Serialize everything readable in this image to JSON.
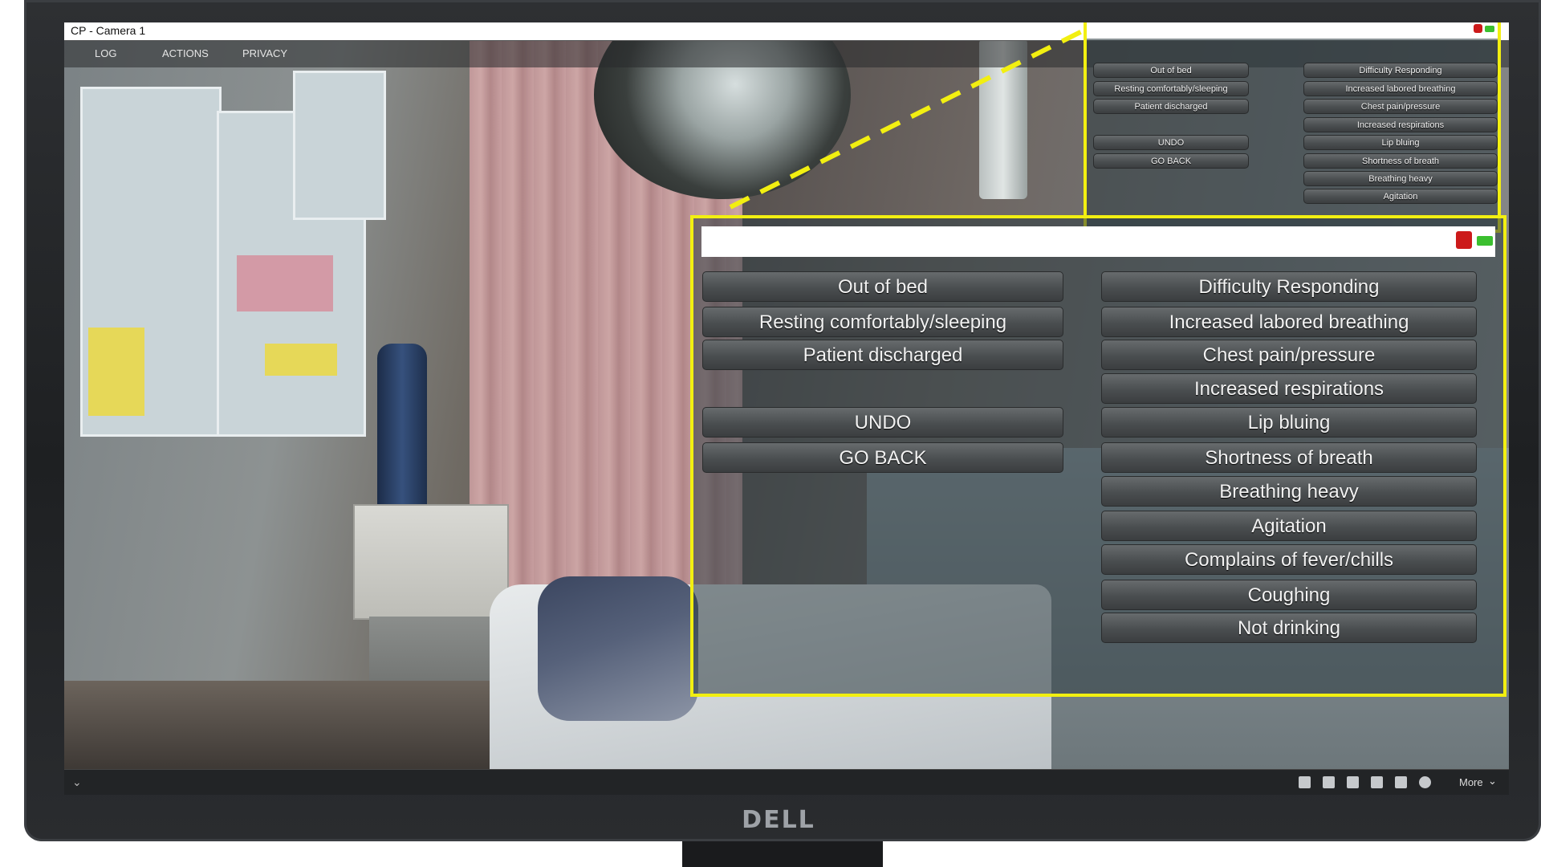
{
  "window": {
    "title": "CP - Camera 1"
  },
  "menu": {
    "items": [
      "LOG",
      "ACTIONS",
      "PRIVACY"
    ]
  },
  "actions_left": [
    "Out of bed",
    "Resting comfortably/sleeping",
    "Patient discharged"
  ],
  "controls": {
    "undo": "UNDO",
    "go_back": "GO BACK"
  },
  "actions_right": [
    "Difficulty Responding",
    "Increased labored breathing",
    "Chest pain/pressure",
    "Increased respirations",
    "Lip bluing",
    "Shortness of breath",
    "Breathing heavy",
    "Agitation",
    "Complains of fever/chills",
    "Coughing",
    "Not drinking"
  ],
  "toolbar": {
    "more_label": "More",
    "icons": [
      "zoom-icon",
      "camera-icon",
      "chat-icon",
      "network-icon",
      "lock-icon",
      "settings-icon"
    ]
  },
  "monitor": {
    "brand": "DELL"
  },
  "colors": {
    "highlight": "#f2ef11",
    "status_red": "#cc1a1a",
    "status_green": "#3bbf2f"
  }
}
